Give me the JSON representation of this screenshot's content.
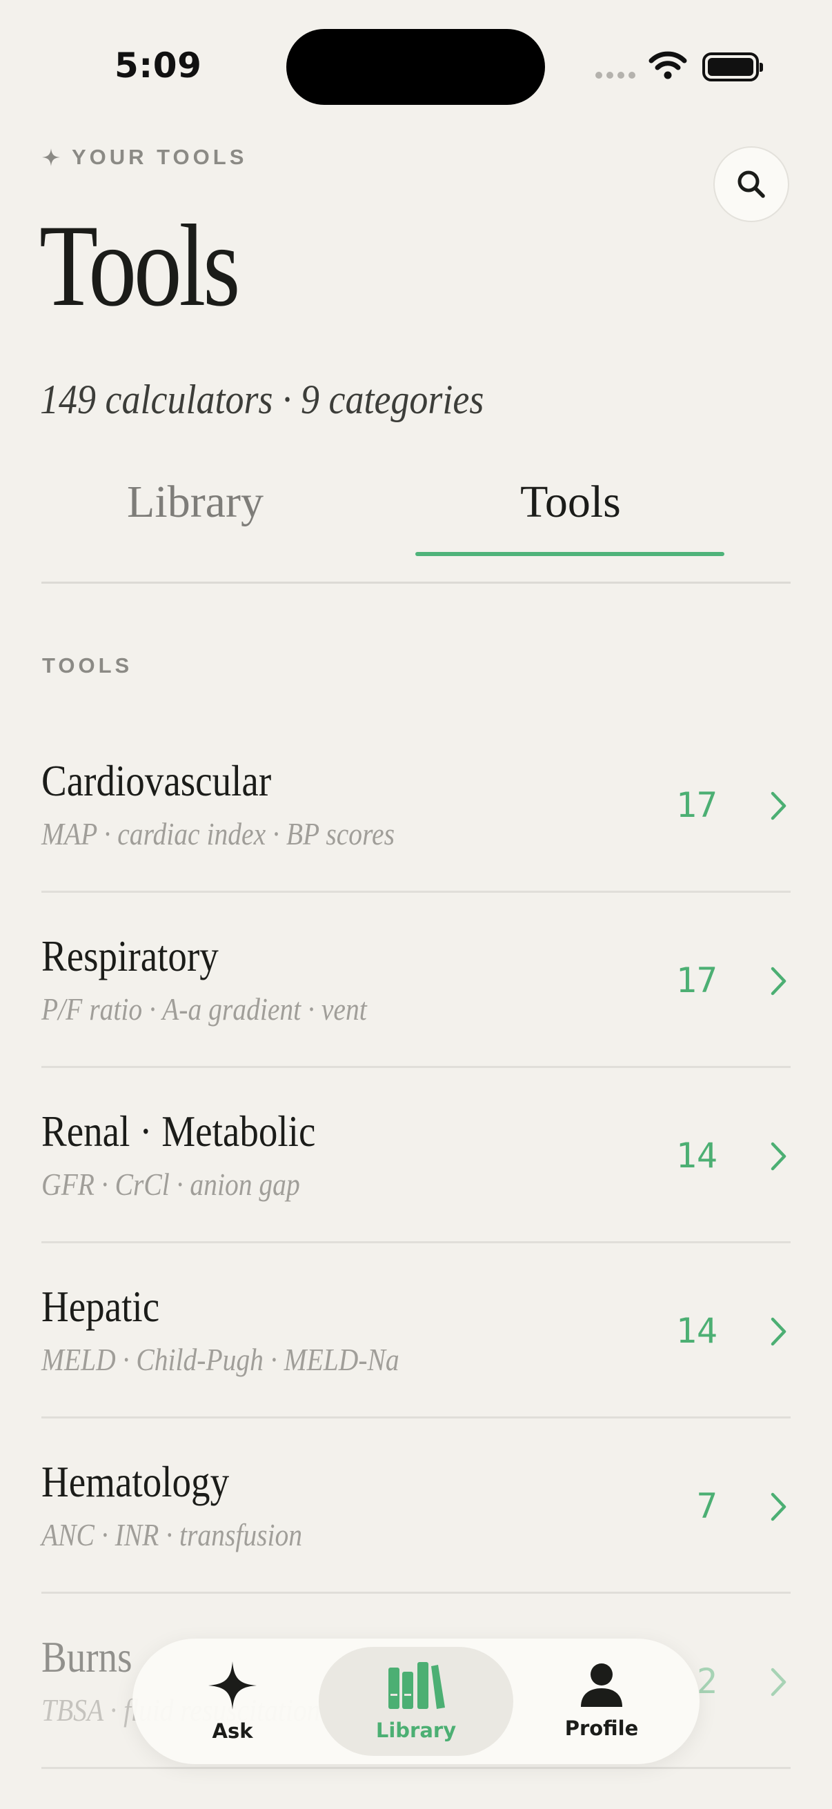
{
  "status_bar": {
    "time": "5:09"
  },
  "header": {
    "eyebrow": "YOUR TOOLS",
    "title": "Tools",
    "subtitle": "149 calculators · 9 categories"
  },
  "segments": {
    "library": "Library",
    "tools": "Tools",
    "active": "Tools"
  },
  "section_label": "TOOLS",
  "categories": [
    {
      "title": "Cardiovascular",
      "subtitle": "MAP · cardiac index · BP scores",
      "count": "17"
    },
    {
      "title": "Respiratory",
      "subtitle": "P/F ratio · A-a gradient · vent",
      "count": "17"
    },
    {
      "title": "Renal · Metabolic",
      "subtitle": "GFR · CrCl · anion gap",
      "count": "14"
    },
    {
      "title": "Hepatic",
      "subtitle": "MELD · Child-Pugh · MELD-Na",
      "count": "14"
    },
    {
      "title": "Hematology",
      "subtitle": "ANC · INR · transfusion",
      "count": "7"
    },
    {
      "title": "Burns",
      "subtitle": "TBSA · fluid resuscitation",
      "count": "2"
    }
  ],
  "tab_bar": {
    "ask": "Ask",
    "library": "Library",
    "profile": "Profile",
    "active": "Library"
  },
  "icons": {
    "search": "search-icon",
    "eyebrow": "sparkle-icon",
    "row_chevron": "chevron-right-icon",
    "ask": "sparkle-icon",
    "library": "books-icon",
    "profile": "person-icon"
  },
  "colors": {
    "background": "#f3f1ec",
    "accent": "#4caf73",
    "text": "#1b1c19",
    "muted": "#8b8a85"
  }
}
